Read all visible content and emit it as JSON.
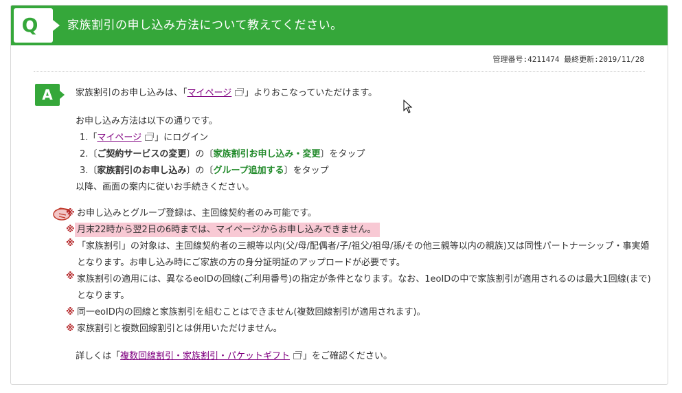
{
  "question": {
    "badge": "Q",
    "title": "家族割引の申し込み方法について教えてください。"
  },
  "meta": {
    "text": "管理番号:4211474 最終更新:2019/11/28"
  },
  "answer": {
    "badge": "A",
    "intro_pre": "家族割引のお申し込みは、「",
    "intro_link": "マイページ",
    "intro_post": "」よりおこなっていただけます。",
    "method_heading": "お申し込み方法は以下の通りです。",
    "steps": {
      "s1_num": "1.「",
      "s1_link": "マイページ",
      "s1_post": "」にログイン",
      "s2_num": "2.〔",
      "s2_bold": "ご契約サービスの変更",
      "s2_mid": "〕の〔",
      "s2_green": "家族割引お申し込み・変更",
      "s2_post": "〕をタップ",
      "s3_num": "3.〔",
      "s3_bold": "家族割引のお申し込み",
      "s3_mid": "〕の〔",
      "s3_green": "グループ追加する",
      "s3_post": "〕をタップ"
    },
    "after_steps": "以降、画面の案内に従いお手続きください。",
    "notes_mark": "※",
    "notes": {
      "n1": "お申し込みとグループ登録は、主回線契約者のみ可能です。",
      "n2": "月末22時から翌2日の6時までは、マイページからお申し込みできません。",
      "n3": "「家族割引」の対象は、主回線契約者の三親等以内(父/母/配偶者/子/祖父/祖母/孫/その他三親等以内の親族)又は同性パートナーシップ・事実婚となります。お申し込み時にご家族の方の身分証明証のアップロードが必要です。",
      "n4": "家族割引の適用には、異なるeoIDの回線(ご利用番号)の指定が条件となります。なお、1eoIDの中で家族割引が適用されるのは最大1回線(まで)となります。",
      "n5": "同一eoID内の回線と家族割引を組むことはできません(複数回線割引が適用されます)。",
      "n6": "家族割引と複数回線割引とは併用いただけません。"
    },
    "detail_pre": "詳しくは「",
    "detail_link": "複数回線割引・家族割引・パケットギフト",
    "detail_post": "」をご確認ください。"
  },
  "colors": {
    "brand_green": "#35a73a",
    "note_mark": "#b5282b",
    "highlight": "#f8c9d4",
    "link": "#800080"
  },
  "icons": {
    "external": "external-window-icon",
    "hand": "pointing-hand-icon",
    "cursor": "mouse-cursor-icon"
  }
}
